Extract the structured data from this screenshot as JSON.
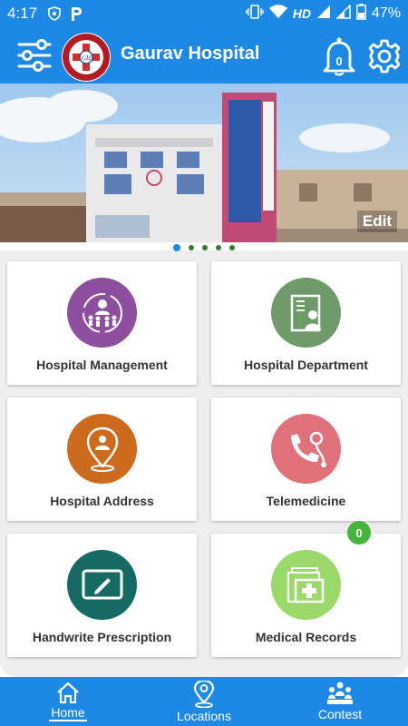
{
  "status_bar": {
    "time": "4:17",
    "network_type": "HD",
    "battery": "47%"
  },
  "app_bar": {
    "title": "Gaurav Hospital",
    "notification_count": "0",
    "logo_text": "GAURAV HOSPITAL"
  },
  "banner": {
    "edit_label": "Edit",
    "slide_count": 5,
    "active_slide": 1
  },
  "cards": [
    {
      "label": "Hospital Management",
      "icon": "management-icon",
      "color": "#8e4f9e"
    },
    {
      "label": "Hospital Department",
      "icon": "doctor-profile-icon",
      "color": "#6f9a6a"
    },
    {
      "label": "Hospital Address",
      "icon": "location-pin-icon",
      "color": "#cc6a1e"
    },
    {
      "label": "Telemedicine",
      "icon": "phone-stethoscope-icon",
      "color": "#e07079"
    },
    {
      "label": "Handwrite Prescription",
      "icon": "tablet-pen-icon",
      "color": "#156b63"
    },
    {
      "label": "Medical Records",
      "icon": "records-folder-icon",
      "color": "#9ad96a",
      "badge": "0"
    }
  ],
  "bottom_nav": {
    "items": [
      {
        "label": "Home",
        "icon": "home-icon",
        "active": true
      },
      {
        "label": "Locations",
        "icon": "location-icon",
        "active": false
      },
      {
        "label": "Contest",
        "icon": "contest-icon",
        "active": false
      }
    ]
  },
  "colors": {
    "primary": "#1e88e5",
    "grid_background": "#eeeeee",
    "badge": "#43b53a"
  }
}
